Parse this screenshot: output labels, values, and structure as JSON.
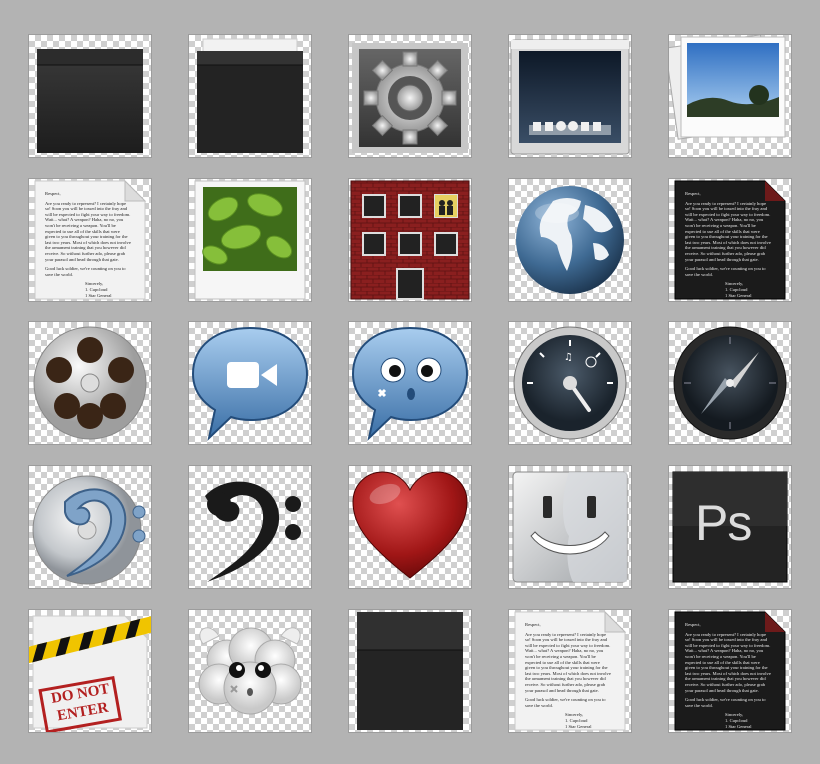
{
  "background_color": "#b3b3b3",
  "document": {
    "greeting": "Respect,",
    "body": "Are you ready to represent? I certainly hope so! Soon you will be tossed into the fray and will be expected to fight your way to freedom. Wait... what? A weapon? Haha, no no, you won't be receiving a weapon. You'll be expected to use all of the skills that were given to you throughout your training for the last two years. Most of which does not involve the armament training that you however did receive. So without further ado, please grab your parasol and head through that gate.",
    "closing": "Good luck soldier, we're counting on you to save the world.",
    "signoff": "Sincerely,",
    "signer": "1. Cupcloud",
    "title": "1 Star General"
  },
  "icons": [
    {
      "row": 0,
      "col": 0,
      "name": "black-box-icon"
    },
    {
      "row": 0,
      "col": 1,
      "name": "open-black-box-icon"
    },
    {
      "row": 0,
      "col": 2,
      "name": "gear-icon"
    },
    {
      "row": 0,
      "col": 3,
      "name": "desktop-screen-icon"
    },
    {
      "row": 0,
      "col": 4,
      "name": "photos-icon"
    },
    {
      "row": 1,
      "col": 0,
      "name": "white-document-icon"
    },
    {
      "row": 1,
      "col": 1,
      "name": "leaf-photo-icon"
    },
    {
      "row": 1,
      "col": 2,
      "name": "brick-building-icon"
    },
    {
      "row": 1,
      "col": 3,
      "name": "globe-icon"
    },
    {
      "row": 1,
      "col": 4,
      "name": "black-document-icon"
    },
    {
      "row": 2,
      "col": 0,
      "name": "film-reel-icon"
    },
    {
      "row": 2,
      "col": 1,
      "name": "video-chat-bubble-icon"
    },
    {
      "row": 2,
      "col": 2,
      "name": "chat-face-bubble-icon"
    },
    {
      "row": 2,
      "col": 3,
      "name": "dashboard-gauge-icon"
    },
    {
      "row": 2,
      "col": 4,
      "name": "compass-icon"
    },
    {
      "row": 3,
      "col": 0,
      "name": "bass-clef-disc-icon"
    },
    {
      "row": 3,
      "col": 1,
      "name": "bass-clef-icon"
    },
    {
      "row": 3,
      "col": 2,
      "name": "heart-icon"
    },
    {
      "row": 3,
      "col": 3,
      "name": "finder-face-icon"
    },
    {
      "row": 3,
      "col": 4,
      "name": "photoshop-icon"
    },
    {
      "row": 4,
      "col": 0,
      "name": "do-not-enter-icon"
    },
    {
      "row": 4,
      "col": 1,
      "name": "winged-cloud-icon"
    },
    {
      "row": 4,
      "col": 2,
      "name": "black-box-front-icon"
    },
    {
      "row": 4,
      "col": 3,
      "name": "white-document-icon"
    },
    {
      "row": 4,
      "col": 4,
      "name": "black-document-icon"
    }
  ],
  "sign": {
    "line1": "DO NOT",
    "line2": "ENTER"
  },
  "photoshop": {
    "label": "Ps"
  }
}
